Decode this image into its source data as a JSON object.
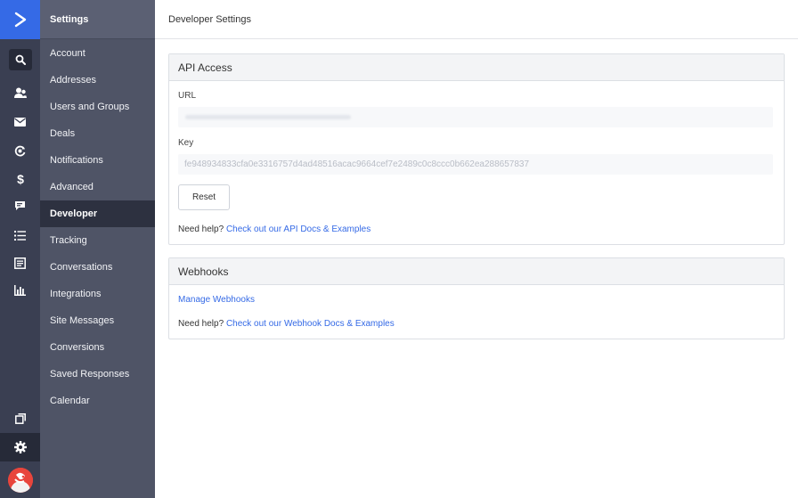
{
  "rail": {
    "icons": [
      "logo-chevron-icon",
      "search-icon",
      "contacts-icon",
      "campaigns-icon",
      "automations-icon",
      "deals-icon",
      "conversations-icon",
      "lists-icon",
      "forms-icon",
      "reports-icon",
      "pages-icon",
      "settings-gear-icon",
      "user-avatar"
    ]
  },
  "sidebar": {
    "title": "Settings",
    "items": [
      {
        "label": "Account"
      },
      {
        "label": "Addresses"
      },
      {
        "label": "Users and Groups"
      },
      {
        "label": "Deals"
      },
      {
        "label": "Notifications"
      },
      {
        "label": "Advanced"
      },
      {
        "label": "Developer",
        "active": true
      },
      {
        "label": "Tracking"
      },
      {
        "label": "Conversations"
      },
      {
        "label": "Integrations"
      },
      {
        "label": "Site Messages"
      },
      {
        "label": "Conversions"
      },
      {
        "label": "Saved Responses"
      },
      {
        "label": "Calendar"
      }
    ]
  },
  "header": {
    "title": "Developer Settings"
  },
  "api_access": {
    "title": "API Access",
    "url_label": "URL",
    "url_value_hidden": true,
    "key_label": "Key",
    "key_value": "fe948934833cfa0e3316757d4ad48516acac9664cef7e2489c0c8ccc0b662ea288657837",
    "reset_label": "Reset",
    "help_prefix": "Need help?",
    "help_link": "Check out our API Docs & Examples"
  },
  "webhooks": {
    "title": "Webhooks",
    "manage_link": "Manage Webhooks",
    "help_prefix": "Need help?",
    "help_link": "Check out our Webhook Docs & Examples"
  },
  "colors": {
    "accent": "#356ae6",
    "rail": "#3a3f52",
    "sidebar": "#4f5466",
    "active": "#2d3140"
  }
}
